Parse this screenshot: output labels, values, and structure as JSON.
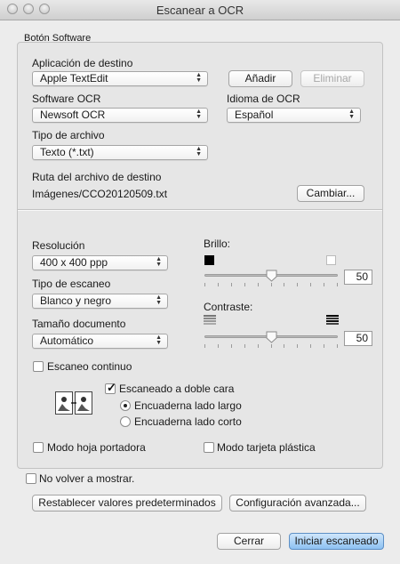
{
  "window": {
    "title": "Escanear a OCR"
  },
  "group_label": "Botón Software",
  "app": {
    "label": "Aplicación de destino",
    "value": "Apple TextEdit",
    "add_button": "Añadir",
    "remove_button": "Eliminar"
  },
  "ocr_software": {
    "label": "Software OCR",
    "value": "Newsoft OCR"
  },
  "ocr_language": {
    "label": "Idioma de OCR",
    "value": "Español"
  },
  "file_type": {
    "label": "Tipo de archivo",
    "value": "Texto (*.txt)"
  },
  "dest_path": {
    "label": "Ruta del archivo de destino",
    "value": "Imágenes/CCO20120509.txt",
    "change_button": "Cambiar..."
  },
  "resolution": {
    "label": "Resolución",
    "value": "400 x 400 ppp"
  },
  "scan_type": {
    "label": "Tipo de escaneo",
    "value": "Blanco y negro"
  },
  "doc_size": {
    "label": "Tamaño documento",
    "value": "Automático"
  },
  "brightness": {
    "label": "Brillo:",
    "value": "50",
    "level": 0.5
  },
  "contrast": {
    "label": "Contraste:",
    "value": "50",
    "level": 0.5
  },
  "continuous": {
    "label": "Escaneo continuo",
    "checked": false
  },
  "duplex": {
    "label": "Escaneado a doble cara",
    "checked": true,
    "options": [
      "Encuaderna lado largo",
      "Encuaderna lado corto"
    ],
    "selected": 0
  },
  "carrier_sheet": {
    "label": "Modo hoja portadora",
    "checked": false
  },
  "plastic_card": {
    "label": "Modo tarjeta plástica",
    "checked": false
  },
  "dont_show": {
    "label": "No volver a mostrar.",
    "checked": false
  },
  "buttons": {
    "restore": "Restablecer valores predeterminados",
    "advanced": "Configuración avanzada...",
    "cancel": "Cerrar",
    "start": "Iniciar escaneado"
  }
}
